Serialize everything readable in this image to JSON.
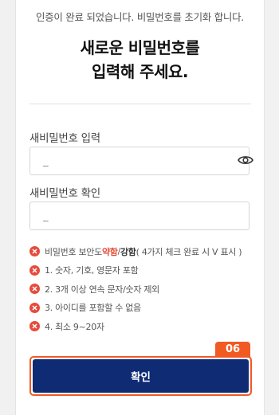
{
  "notice": "인증이 완료 되었습니다. 비밀번호를 초기화 합니다.",
  "title": {
    "line1_bold": "새로운 비밀번호",
    "line1_suffix": "를",
    "line2": "입력해 주세요."
  },
  "new_password": {
    "label": "새비밀번호 입력",
    "placeholder": "_"
  },
  "confirm_password": {
    "label": "새비밀번호 확인",
    "placeholder": "_"
  },
  "rules": {
    "strength": {
      "prefix": "비밀번호 보안도 ",
      "weak": "약함",
      "separator": " / ",
      "strong": "강함",
      "suffix": " ( 4가지 체크 완료 시 V 표시 )"
    },
    "items": [
      "1. 숫자, 기호, 영문자 포함",
      "2. 3개 이상 연속 문자/숫자 제외",
      "3. 아이디를 포함할 수 없음",
      "4. 최소 9~20자"
    ]
  },
  "step_badge": "06",
  "confirm_button": "확인",
  "icons": {
    "visibility": "eye-icon",
    "rule_status": "x-circle-icon"
  },
  "colors": {
    "primary": "#0f2b73",
    "error": "#e64b3c",
    "highlight": "#f15a22"
  }
}
